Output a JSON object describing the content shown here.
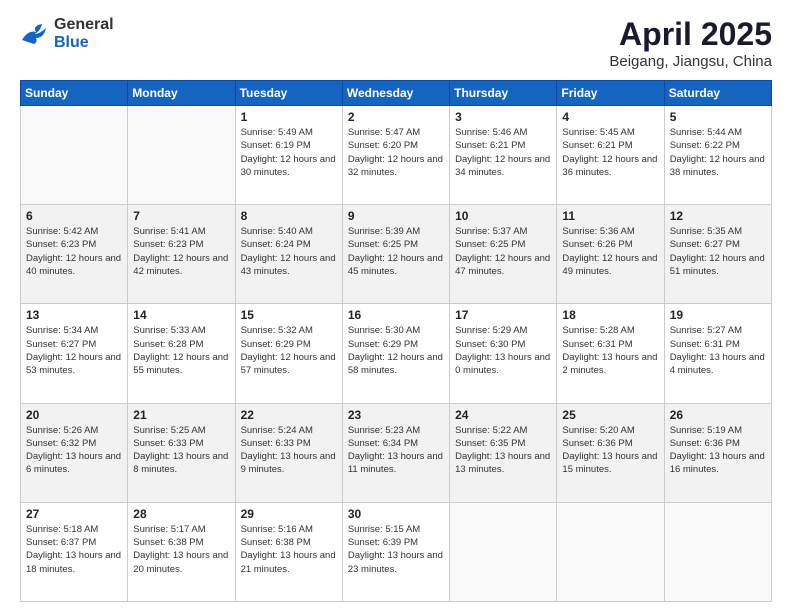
{
  "header": {
    "logo_general": "General",
    "logo_blue": "Blue",
    "title": "April 2025",
    "location": "Beigang, Jiangsu, China"
  },
  "weekdays": [
    "Sunday",
    "Monday",
    "Tuesday",
    "Wednesday",
    "Thursday",
    "Friday",
    "Saturday"
  ],
  "weeks": [
    [
      {
        "day": "",
        "info": ""
      },
      {
        "day": "",
        "info": ""
      },
      {
        "day": "1",
        "info": "Sunrise: 5:49 AM\nSunset: 6:19 PM\nDaylight: 12 hours and 30 minutes."
      },
      {
        "day": "2",
        "info": "Sunrise: 5:47 AM\nSunset: 6:20 PM\nDaylight: 12 hours and 32 minutes."
      },
      {
        "day": "3",
        "info": "Sunrise: 5:46 AM\nSunset: 6:21 PM\nDaylight: 12 hours and 34 minutes."
      },
      {
        "day": "4",
        "info": "Sunrise: 5:45 AM\nSunset: 6:21 PM\nDaylight: 12 hours and 36 minutes."
      },
      {
        "day": "5",
        "info": "Sunrise: 5:44 AM\nSunset: 6:22 PM\nDaylight: 12 hours and 38 minutes."
      }
    ],
    [
      {
        "day": "6",
        "info": "Sunrise: 5:42 AM\nSunset: 6:23 PM\nDaylight: 12 hours and 40 minutes."
      },
      {
        "day": "7",
        "info": "Sunrise: 5:41 AM\nSunset: 6:23 PM\nDaylight: 12 hours and 42 minutes."
      },
      {
        "day": "8",
        "info": "Sunrise: 5:40 AM\nSunset: 6:24 PM\nDaylight: 12 hours and 43 minutes."
      },
      {
        "day": "9",
        "info": "Sunrise: 5:39 AM\nSunset: 6:25 PM\nDaylight: 12 hours and 45 minutes."
      },
      {
        "day": "10",
        "info": "Sunrise: 5:37 AM\nSunset: 6:25 PM\nDaylight: 12 hours and 47 minutes."
      },
      {
        "day": "11",
        "info": "Sunrise: 5:36 AM\nSunset: 6:26 PM\nDaylight: 12 hours and 49 minutes."
      },
      {
        "day": "12",
        "info": "Sunrise: 5:35 AM\nSunset: 6:27 PM\nDaylight: 12 hours and 51 minutes."
      }
    ],
    [
      {
        "day": "13",
        "info": "Sunrise: 5:34 AM\nSunset: 6:27 PM\nDaylight: 12 hours and 53 minutes."
      },
      {
        "day": "14",
        "info": "Sunrise: 5:33 AM\nSunset: 6:28 PM\nDaylight: 12 hours and 55 minutes."
      },
      {
        "day": "15",
        "info": "Sunrise: 5:32 AM\nSunset: 6:29 PM\nDaylight: 12 hours and 57 minutes."
      },
      {
        "day": "16",
        "info": "Sunrise: 5:30 AM\nSunset: 6:29 PM\nDaylight: 12 hours and 58 minutes."
      },
      {
        "day": "17",
        "info": "Sunrise: 5:29 AM\nSunset: 6:30 PM\nDaylight: 13 hours and 0 minutes."
      },
      {
        "day": "18",
        "info": "Sunrise: 5:28 AM\nSunset: 6:31 PM\nDaylight: 13 hours and 2 minutes."
      },
      {
        "day": "19",
        "info": "Sunrise: 5:27 AM\nSunset: 6:31 PM\nDaylight: 13 hours and 4 minutes."
      }
    ],
    [
      {
        "day": "20",
        "info": "Sunrise: 5:26 AM\nSunset: 6:32 PM\nDaylight: 13 hours and 6 minutes."
      },
      {
        "day": "21",
        "info": "Sunrise: 5:25 AM\nSunset: 6:33 PM\nDaylight: 13 hours and 8 minutes."
      },
      {
        "day": "22",
        "info": "Sunrise: 5:24 AM\nSunset: 6:33 PM\nDaylight: 13 hours and 9 minutes."
      },
      {
        "day": "23",
        "info": "Sunrise: 5:23 AM\nSunset: 6:34 PM\nDaylight: 13 hours and 11 minutes."
      },
      {
        "day": "24",
        "info": "Sunrise: 5:22 AM\nSunset: 6:35 PM\nDaylight: 13 hours and 13 minutes."
      },
      {
        "day": "25",
        "info": "Sunrise: 5:20 AM\nSunset: 6:36 PM\nDaylight: 13 hours and 15 minutes."
      },
      {
        "day": "26",
        "info": "Sunrise: 5:19 AM\nSunset: 6:36 PM\nDaylight: 13 hours and 16 minutes."
      }
    ],
    [
      {
        "day": "27",
        "info": "Sunrise: 5:18 AM\nSunset: 6:37 PM\nDaylight: 13 hours and 18 minutes."
      },
      {
        "day": "28",
        "info": "Sunrise: 5:17 AM\nSunset: 6:38 PM\nDaylight: 13 hours and 20 minutes."
      },
      {
        "day": "29",
        "info": "Sunrise: 5:16 AM\nSunset: 6:38 PM\nDaylight: 13 hours and 21 minutes."
      },
      {
        "day": "30",
        "info": "Sunrise: 5:15 AM\nSunset: 6:39 PM\nDaylight: 13 hours and 23 minutes."
      },
      {
        "day": "",
        "info": ""
      },
      {
        "day": "",
        "info": ""
      },
      {
        "day": "",
        "info": ""
      }
    ]
  ]
}
